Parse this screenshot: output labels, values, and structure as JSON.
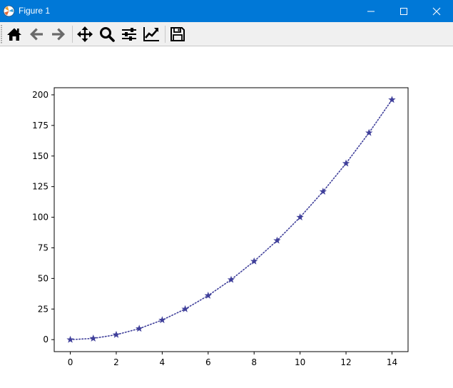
{
  "window": {
    "title": "Figure 1",
    "colors": {
      "titlebar": "#0078d7",
      "toolbar": "#f0f0f0"
    }
  },
  "toolbar": {
    "buttons": [
      {
        "icon": "home-icon",
        "enabled": true
      },
      {
        "icon": "back-arrow-icon",
        "enabled": false
      },
      {
        "icon": "forward-arrow-icon",
        "enabled": false
      },
      {
        "icon": "pan-icon",
        "enabled": true
      },
      {
        "icon": "zoom-icon",
        "enabled": true
      },
      {
        "icon": "configure-subplots-icon",
        "enabled": true
      },
      {
        "icon": "edit-axis-icon",
        "enabled": true
      },
      {
        "icon": "save-icon",
        "enabled": true
      }
    ]
  },
  "chart_data": {
    "type": "line",
    "x": [
      0,
      1,
      2,
      3,
      4,
      5,
      6,
      7,
      8,
      9,
      10,
      11,
      12,
      13,
      14
    ],
    "series": [
      {
        "values": [
          0,
          1,
          4,
          9,
          16,
          25,
          36,
          49,
          64,
          81,
          100,
          121,
          144,
          169,
          196
        ],
        "color": "#3f3f9a",
        "line_style": "dotted",
        "marker": "star"
      }
    ],
    "xticks": [
      "0",
      "2",
      "4",
      "6",
      "8",
      "10",
      "12",
      "14"
    ],
    "yticks": [
      "0",
      "25",
      "50",
      "75",
      "100",
      "125",
      "150",
      "175",
      "200"
    ],
    "xlim": [
      -0.7,
      14.7
    ],
    "ylim": [
      -9.8,
      205.8
    ],
    "grid": false
  }
}
